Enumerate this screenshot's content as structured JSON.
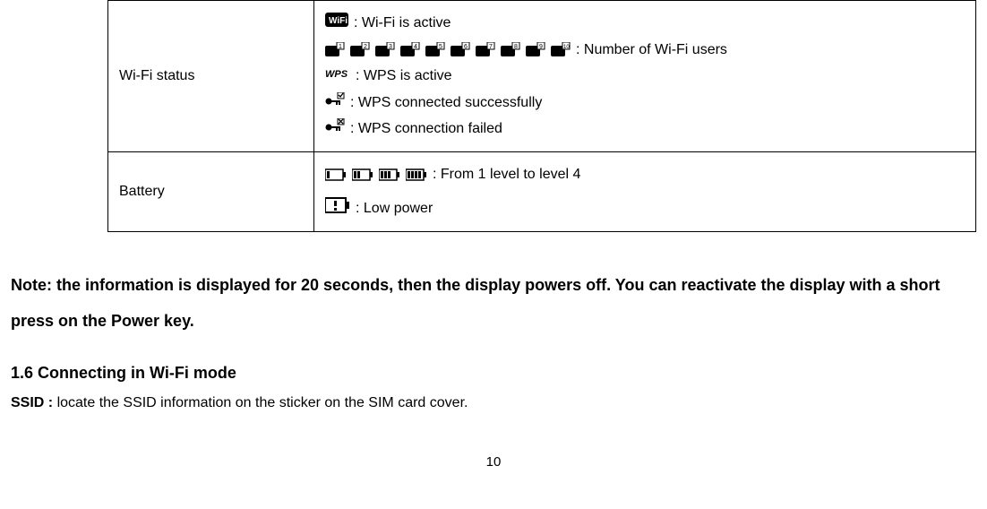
{
  "table": {
    "rows": [
      {
        "label": "Wi-Fi status",
        "lines": [
          {
            "icons": [
              "wifi-icon"
            ],
            "text": ": Wi-Fi is active"
          },
          {
            "icons": [
              "wifi-user-1-icon",
              "wifi-user-2-icon",
              "wifi-user-3-icon",
              "wifi-user-4-icon",
              "wifi-user-5-icon",
              "wifi-user-6-icon",
              "wifi-user-7-icon",
              "wifi-user-8-icon",
              "wifi-user-9-icon",
              "wifi-user-10-icon"
            ],
            "text": ": Number of Wi-Fi users"
          },
          {
            "icons": [
              "wps-icon"
            ],
            "text": ": WPS is active"
          },
          {
            "icons": [
              "wps-connected-icon"
            ],
            "text": ": WPS connected successfully"
          },
          {
            "icons": [
              "wps-failed-icon"
            ],
            "text": ": WPS connection failed"
          }
        ]
      },
      {
        "label": "Battery",
        "lines": [
          {
            "icons": [
              "battery-1-icon",
              "battery-2-icon",
              "battery-3-icon",
              "battery-4-icon"
            ],
            "text": ": From 1 level to level 4"
          },
          {
            "icons": [
              "battery-low-icon"
            ],
            "text": ": Low power"
          }
        ]
      }
    ]
  },
  "note": "Note: the information is displayed for 20 seconds, then the display powers off. You can reactivate the display with a short press on the Power key.",
  "section_heading": "1.6 Connecting in Wi-Fi mode",
  "ssid_label": "SSID : ",
  "ssid_text": "locate the SSID information on the sticker on the SIM card cover.",
  "page_number": "10"
}
